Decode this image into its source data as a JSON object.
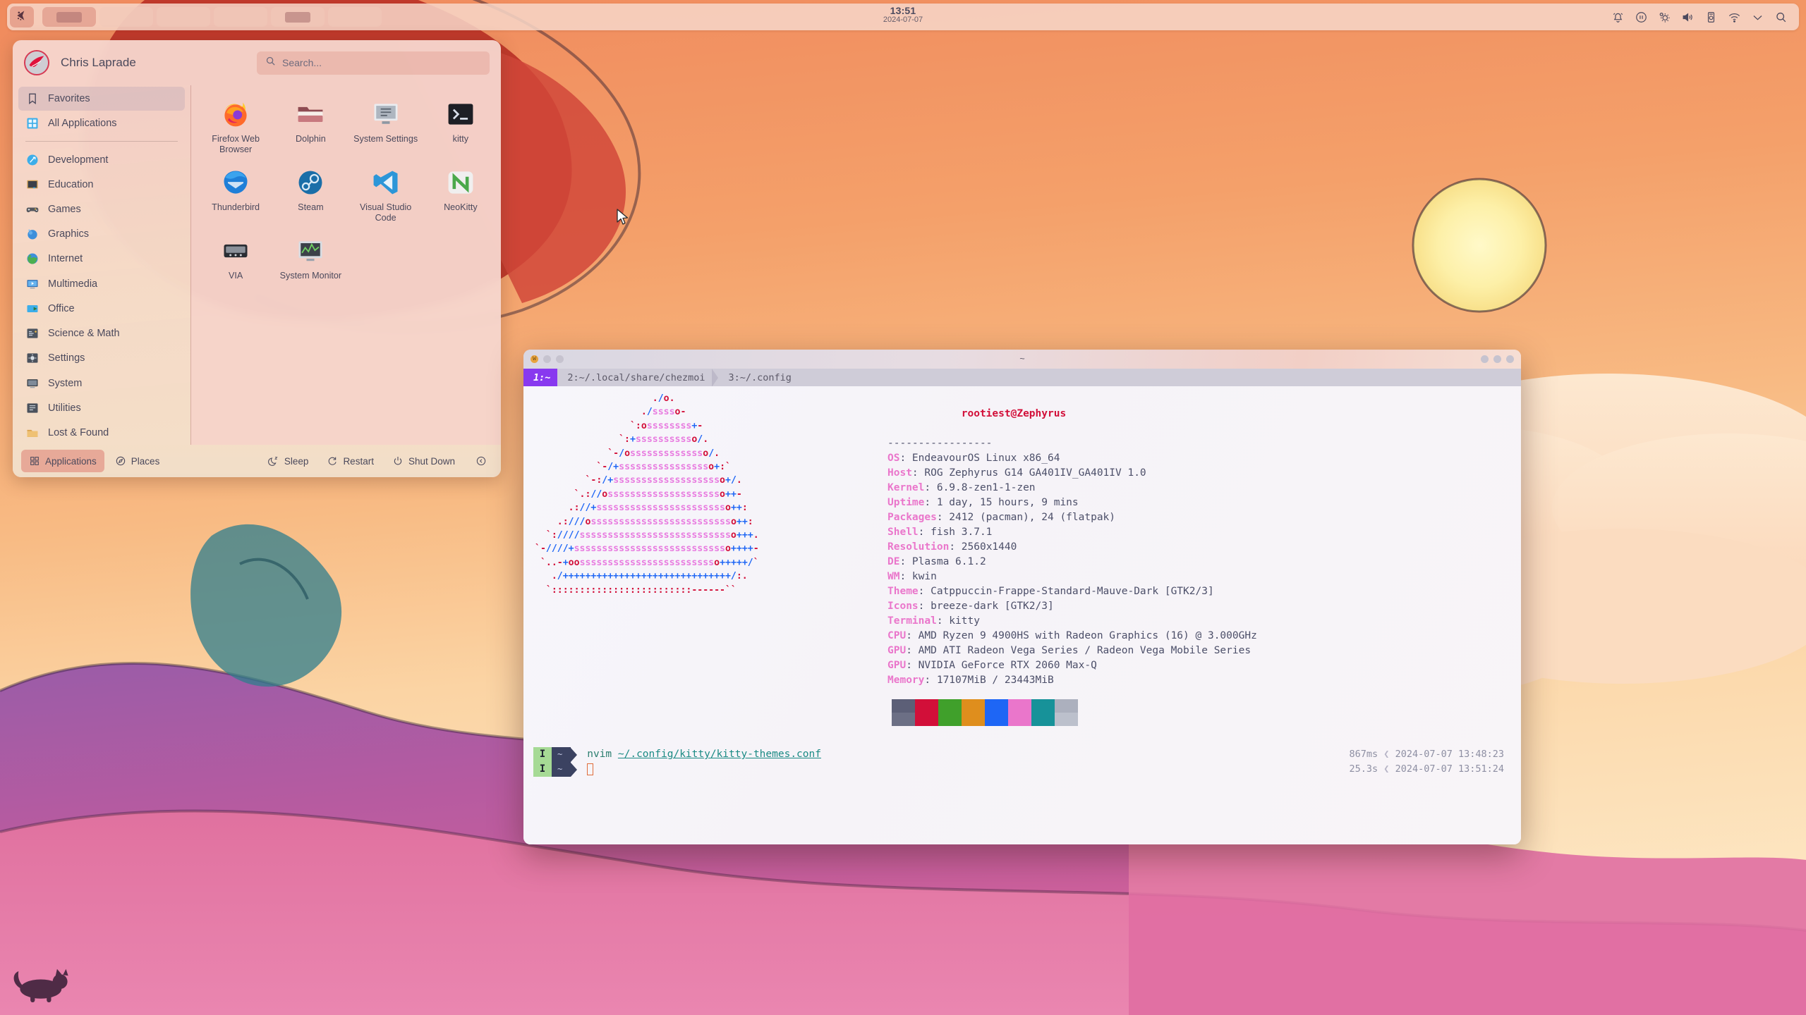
{
  "panel": {
    "kickoff_icon": "endeavouros-logo-icon",
    "clock": {
      "time": "13:51",
      "date": "2024-07-07"
    },
    "tasks": [
      {
        "name": "task-1",
        "has_window": true,
        "active": true
      },
      {
        "name": "task-2",
        "has_window": false,
        "active": false
      },
      {
        "name": "task-3",
        "has_window": false,
        "active": false
      },
      {
        "name": "task-4",
        "has_window": false,
        "active": false
      },
      {
        "name": "task-5",
        "has_window": true,
        "active": false
      },
      {
        "name": "task-6",
        "has_window": false,
        "active": false
      }
    ],
    "tray": [
      "notification-bell-icon",
      "media-pause-icon",
      "brightness-icon",
      "volume-icon",
      "device-notifier-icon",
      "wifi-icon",
      "chevron-down-icon",
      "search-icon"
    ]
  },
  "menu": {
    "user": {
      "name": "Chris Laprade",
      "avatar": "user-avatar"
    },
    "search": {
      "value": "",
      "placeholder": "Search..."
    },
    "sidebar": [
      {
        "label": "Favorites",
        "icon": "bookmark-icon",
        "selected": true
      },
      {
        "label": "All Applications",
        "icon": "grid-apps-icon",
        "selected": false
      },
      {
        "label": "Development",
        "icon": "development-icon",
        "selected": false
      },
      {
        "label": "Education",
        "icon": "education-icon",
        "selected": false
      },
      {
        "label": "Games",
        "icon": "gamepad-icon",
        "selected": false
      },
      {
        "label": "Graphics",
        "icon": "graphics-icon",
        "selected": false
      },
      {
        "label": "Internet",
        "icon": "globe-icon",
        "selected": false
      },
      {
        "label": "Multimedia",
        "icon": "multimedia-icon",
        "selected": false
      },
      {
        "label": "Office",
        "icon": "office-icon",
        "selected": false
      },
      {
        "label": "Science & Math",
        "icon": "science-icon",
        "selected": false
      },
      {
        "label": "Settings",
        "icon": "settings-icon",
        "selected": false
      },
      {
        "label": "System",
        "icon": "system-icon",
        "selected": false
      },
      {
        "label": "Utilities",
        "icon": "utilities-icon",
        "selected": false
      },
      {
        "label": "Lost & Found",
        "icon": "lost-found-icon",
        "selected": false
      }
    ],
    "apps": [
      {
        "label": "Firefox Web Browser",
        "icon": "firefox-icon"
      },
      {
        "label": "Dolphin",
        "icon": "dolphin-icon"
      },
      {
        "label": "System Settings",
        "icon": "system-settings-icon"
      },
      {
        "label": "kitty",
        "icon": "kitty-icon"
      },
      {
        "label": "Thunderbird",
        "icon": "thunderbird-icon"
      },
      {
        "label": "Steam",
        "icon": "steam-icon"
      },
      {
        "label": "Visual Studio Code",
        "icon": "vscode-icon"
      },
      {
        "label": "NeoKitty",
        "icon": "neokitty-icon"
      },
      {
        "label": "VIA",
        "icon": "via-icon"
      },
      {
        "label": "System Monitor",
        "icon": "system-monitor-icon"
      }
    ],
    "footer": {
      "left": [
        {
          "label": "Applications",
          "icon": "grid-apps-icon",
          "active": true
        },
        {
          "label": "Places",
          "icon": "compass-icon",
          "active": false
        }
      ],
      "right": [
        {
          "label": "Sleep",
          "icon": "moon-icon",
          "active": false
        },
        {
          "label": "Restart",
          "icon": "restart-icon",
          "active": false
        },
        {
          "label": "Shut Down",
          "icon": "power-icon",
          "active": false
        }
      ],
      "collapse": {
        "label": "",
        "icon": "collapse-left-icon"
      }
    }
  },
  "terminal": {
    "title": "~",
    "window_buttons": [
      "close-button",
      "minimize-button",
      "maximize-button"
    ],
    "tabs": [
      {
        "label": "1:~",
        "active": true
      },
      {
        "label": "2:~/.local/share/chezmoi",
        "active": false
      },
      {
        "label": "3:~/.config",
        "active": false
      }
    ],
    "neofetch": {
      "user_host": "rootiest@Zephyrus",
      "separator": "-----------------",
      "fields": [
        {
          "key": "OS",
          "value": "EndeavourOS Linux x86_64"
        },
        {
          "key": "Host",
          "value": "ROG Zephyrus G14 GA401IV_GA401IV 1.0"
        },
        {
          "key": "Kernel",
          "value": "6.9.8-zen1-1-zen"
        },
        {
          "key": "Uptime",
          "value": "1 day, 15 hours, 9 mins"
        },
        {
          "key": "Packages",
          "value": "2412 (pacman), 24 (flatpak)"
        },
        {
          "key": "Shell",
          "value": "fish 3.7.1"
        },
        {
          "key": "Resolution",
          "value": "2560x1440"
        },
        {
          "key": "DE",
          "value": "Plasma 6.1.2"
        },
        {
          "key": "WM",
          "value": "kwin"
        },
        {
          "key": "Theme",
          "value": "Catppuccin-Frappe-Standard-Mauve-Dark [GTK2/3]"
        },
        {
          "key": "Icons",
          "value": "breeze-dark [GTK2/3]"
        },
        {
          "key": "Terminal",
          "value": "kitty"
        },
        {
          "key": "CPU",
          "value": "AMD Ryzen 9 4900HS with Radeon Graphics (16) @ 3.000GHz"
        },
        {
          "key": "GPU",
          "value": "AMD ATI Radeon Vega Series / Radeon Vega Mobile Series"
        },
        {
          "key": "GPU",
          "value": "NVIDIA GeForce RTX 2060 Max-Q"
        },
        {
          "key": "Memory",
          "value": "17107MiB / 23443MiB"
        }
      ],
      "palette_row1": [
        "#5c5f77",
        "#d20f39",
        "#40a02b",
        "#df8e1d",
        "#1e66f5",
        "#ea76cb",
        "#179299",
        "#acb0be"
      ],
      "palette_row2": [
        "#6c6f85",
        "#d20f39",
        "#40a02b",
        "#df8e1d",
        "#1e66f5",
        "#ea76cb",
        "#179299",
        "#bcc0cc"
      ],
      "ascii_lines": [
        "                     ./o.",
        "                   ./sssso-",
        "                 `:ossssssss+-",
        "               `:+sssssssssso/.",
        "             `-/ossssssssssssso/.",
        "           `-/+sssssssssssssssso+:`",
        "         `-:/+ssssssssssssssssssso+/.",
        "       `.://osssssssssssssssssssso++-",
        "      .://+ssssssssssssssssssssssso++:",
        "    .:///ossssssssssssssssssssssssso++:",
        "  `:////ssssssssssssssssssssssssssso+++.",
        "`-////+ssssssssssssssssssssssssssso++++-",
        " `..-+oosssssssssssssssssssssssso+++++/`",
        "   ./++++++++++++++++++++++++++++++/:.",
        "  `:::::::::::::::::::::::::------``"
      ]
    },
    "prompt": [
      {
        "mode": "I",
        "dir": "~",
        "command": "nvim ",
        "path": "~/.config/kitty/kitty-themes.conf",
        "duration": "867ms",
        "timestamp": "2024-07-07 13:48:23"
      },
      {
        "mode": "I",
        "dir": "~",
        "command": "",
        "path": "",
        "duration": "25.3s",
        "timestamp": "2024-07-07 13:51:24"
      }
    ],
    "chevron": "❮"
  },
  "colors": {
    "accent_purple": "#8839ef",
    "accent_pink": "#ea76cb",
    "accent_red": "#d20f39",
    "accent_blue": "#1e66f5",
    "menu_bg": "#f5d6cd",
    "panel_bg": "#f7d6c8"
  }
}
